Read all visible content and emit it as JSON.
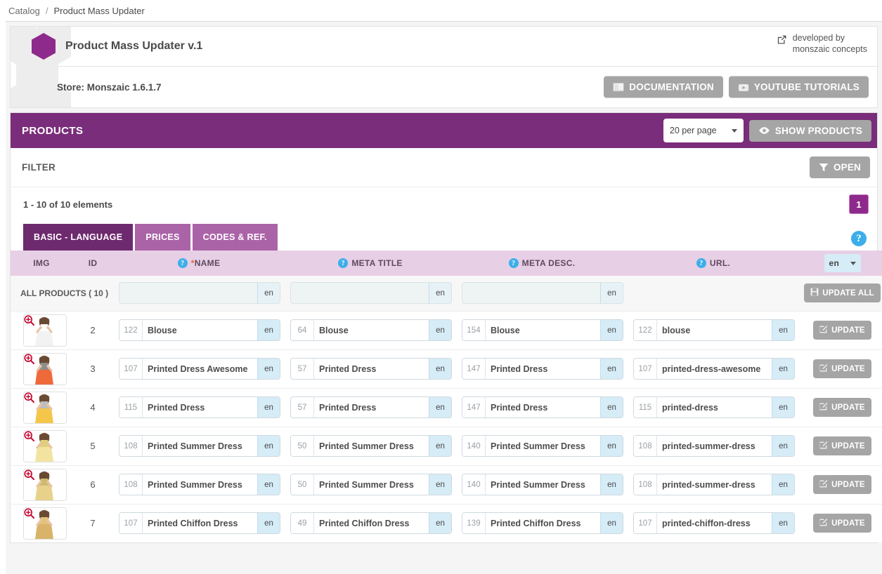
{
  "breadcrumb": {
    "root": "Catalog",
    "separator": "/",
    "current": "Product Mass Updater"
  },
  "module": {
    "title": "Product Mass Updater v.1",
    "store_label": "Store: Monszaic 1.6.1.7",
    "developed_by_line1": "developed by",
    "developed_by_line2": "monszaic concepts",
    "documentation_button": "DOCUMENTATION",
    "youtube_button": "YOUTUBE TUTORIALS"
  },
  "products_panel": {
    "title": "PRODUCTS",
    "per_page_selected": "20 per page",
    "show_products_button": "SHOW PRODUCTS",
    "filter_label": "FILTER",
    "filter_open_button": "OPEN",
    "count_text": "1 - 10 of 10 elements",
    "page_badge": "1",
    "help_glyph": "?"
  },
  "tabs": [
    {
      "label": "BASIC - LANGUAGE",
      "active": true
    },
    {
      "label": "PRICES",
      "active": false
    },
    {
      "label": "CODES & REF.",
      "active": false
    }
  ],
  "table": {
    "headers": {
      "img": "IMG",
      "id": "ID",
      "name": "*NAME",
      "meta_title": "META TITLE",
      "meta_desc": "META DESC.",
      "url": "URL.",
      "lang_selected": "en"
    },
    "all_products_row": {
      "label": "ALL PRODUCTS ( 10 )",
      "name_value": "",
      "name_lang": "en",
      "meta_title_value": "",
      "meta_title_lang": "en",
      "meta_desc_value": "",
      "meta_desc_lang": "en",
      "update_all_button": "UPDATE ALL"
    },
    "row_action_label": "UPDATE",
    "rows": [
      {
        "id": "2",
        "name_count": "122",
        "name": "Blouse",
        "name_lang": "en",
        "meta_title_count": "64",
        "meta_title": "Blouse",
        "meta_title_lang": "en",
        "meta_desc_count": "154",
        "meta_desc": "Blouse",
        "meta_desc_lang": "en",
        "url_count": "122",
        "url": "blouse",
        "url_lang": "en"
      },
      {
        "id": "3",
        "name_count": "107",
        "name": "Printed Dress Awesome",
        "name_lang": "en",
        "meta_title_count": "57",
        "meta_title": "Printed Dress",
        "meta_title_lang": "en",
        "meta_desc_count": "147",
        "meta_desc": "Printed Dress",
        "meta_desc_lang": "en",
        "url_count": "107",
        "url": "printed-dress-awesome",
        "url_lang": "en"
      },
      {
        "id": "4",
        "name_count": "115",
        "name": "Printed Dress",
        "name_lang": "en",
        "meta_title_count": "57",
        "meta_title": "Printed Dress",
        "meta_title_lang": "en",
        "meta_desc_count": "147",
        "meta_desc": "Printed Dress",
        "meta_desc_lang": "en",
        "url_count": "115",
        "url": "printed-dress",
        "url_lang": "en"
      },
      {
        "id": "5",
        "name_count": "108",
        "name": "Printed Summer Dress",
        "name_lang": "en",
        "meta_title_count": "50",
        "meta_title": "Printed Summer Dress",
        "meta_title_lang": "en",
        "meta_desc_count": "140",
        "meta_desc": "Printed Summer Dress",
        "meta_desc_lang": "en",
        "url_count": "108",
        "url": "printed-summer-dress",
        "url_lang": "en"
      },
      {
        "id": "6",
        "name_count": "108",
        "name": "Printed Summer Dress",
        "name_lang": "en",
        "meta_title_count": "50",
        "meta_title": "Printed Summer Dress",
        "meta_title_lang": "en",
        "meta_desc_count": "140",
        "meta_desc": "Printed Summer Dress",
        "meta_desc_lang": "en",
        "url_count": "108",
        "url": "printed-summer-dress",
        "url_lang": "en"
      },
      {
        "id": "7",
        "name_count": "107",
        "name": "Printed Chiffon Dress",
        "name_lang": "en",
        "meta_title_count": "49",
        "meta_title": "Printed Chiffon Dress",
        "meta_title_lang": "en",
        "meta_desc_count": "139",
        "meta_desc": "Printed Chiffon Dress",
        "meta_desc_lang": "en",
        "url_count": "107",
        "url": "printed-chiffon-dress",
        "url_lang": "en"
      }
    ]
  },
  "colors": {
    "brand_purple": "#8e2a8b",
    "panel_purple": "#7a2d7a",
    "tab_inactive": "#ab63a8",
    "header_lilac": "#e7cfe6",
    "grey_button": "#a5a5a5",
    "info_blue": "#3daee9",
    "required_star": "#e8663c"
  },
  "icons": {
    "external_link": "external-link-icon",
    "book": "book-icon",
    "youtube": "youtube-icon",
    "eye": "eye-icon",
    "funnel": "funnel-icon",
    "floppy": "floppy-disk-icon",
    "pencil_square": "pencil-square-icon",
    "magnifier": "magnifier-plus-icon"
  }
}
